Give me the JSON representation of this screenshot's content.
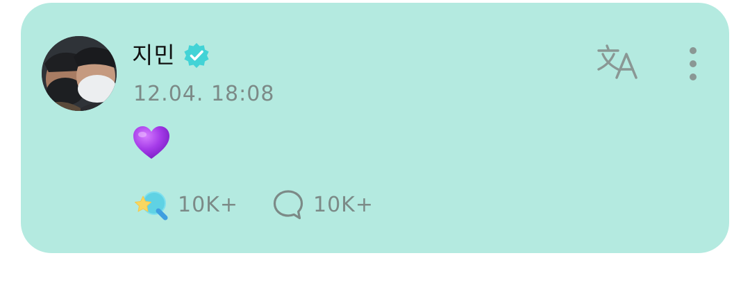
{
  "post": {
    "author_name": "지민",
    "author_verified": true,
    "timestamp": "12.04. 18:08",
    "message_emoji": "purple-heart",
    "reactions_count": "10K+",
    "comments_count": "10K+"
  },
  "icons": {
    "verified": "verified-badge-icon",
    "translate": "translate-icon",
    "more": "more-vertical-icon",
    "reaction": "star-reaction-icon",
    "comment": "comment-bubble-icon"
  },
  "colors": {
    "card_background": "#b4eae0",
    "verified_badge": "#43d3d6",
    "muted_text": "#7c8a87",
    "heart": "#a43ae8"
  }
}
